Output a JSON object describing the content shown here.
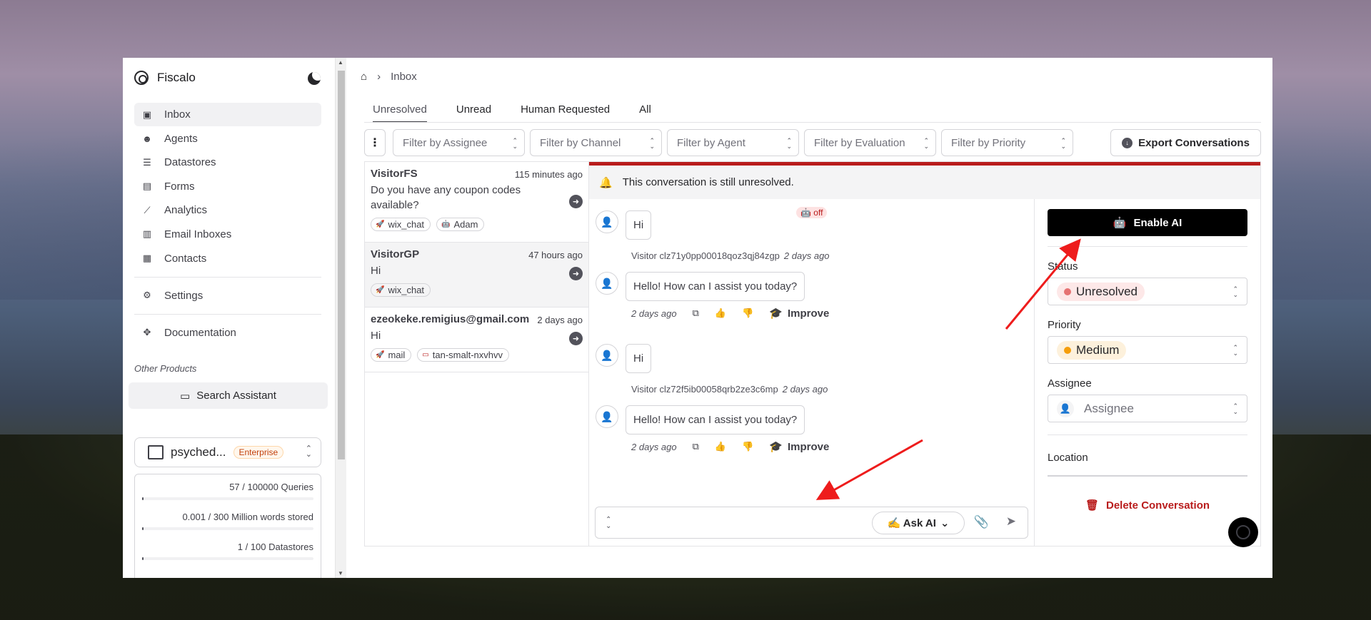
{
  "app": {
    "name": "Fiscalo"
  },
  "sidebar": {
    "items": [
      {
        "label": "Inbox",
        "icon": "inbox-icon",
        "glyph": "▣",
        "active": true
      },
      {
        "label": "Agents",
        "icon": "robot-icon",
        "glyph": "☻"
      },
      {
        "label": "Datastores",
        "icon": "database-icon",
        "glyph": "☰"
      },
      {
        "label": "Forms",
        "icon": "form-icon",
        "glyph": "▤"
      },
      {
        "label": "Analytics",
        "icon": "analytics-icon",
        "glyph": "⟋"
      },
      {
        "label": "Email Inboxes",
        "icon": "mail-inbox-icon",
        "glyph": "▥"
      },
      {
        "label": "Contacts",
        "icon": "contacts-icon",
        "glyph": "▦"
      }
    ],
    "settings": "Settings",
    "documentation": "Documentation",
    "other_products": "Other Products",
    "search_assistant": "Search Assistant",
    "org": {
      "name": "psyched...",
      "plan": "Enterprise"
    },
    "usage": [
      {
        "label": "57 / 100000 Queries",
        "fraction": 0.00057
      },
      {
        "label": "0.001 / 300 Million words stored",
        "fraction": 3.3e-06
      },
      {
        "label": "1 / 100 Datastores",
        "fraction": 0.01
      }
    ]
  },
  "breadcrumb": {
    "current": "Inbox"
  },
  "tabs": [
    "Unresolved",
    "Unread",
    "Human Requested",
    "All"
  ],
  "filters": {
    "assignee": "Filter by Assignee",
    "channel": "Filter by Channel",
    "agent": "Filter by Agent",
    "evaluation": "Filter by Evaluation",
    "priority": "Filter by Priority",
    "export": "Export Conversations"
  },
  "conversations": [
    {
      "name": "VisitorFS",
      "time": "115 minutes ago",
      "message": "Do you have any coupon codes available?",
      "tags": [
        "wix_chat",
        "Adam"
      ]
    },
    {
      "name": "VisitorGP",
      "time": "47 hours ago",
      "message": "Hi",
      "tags": [
        "wix_chat"
      ]
    },
    {
      "name": "ezeokeke.remigius@gmail.com",
      "time": "2 days ago",
      "message": "Hi",
      "tags": [
        "mail",
        "tan-smalt-nxvhvv"
      ]
    }
  ],
  "thread": {
    "banner": "This conversation is still unresolved.",
    "ai_badge": "off",
    "messages": [
      {
        "text": "Hi",
        "sender": "Visitor clz71y0pp00018qoz3qj84zgp",
        "time": "2 days ago"
      },
      {
        "text": "Hello! How can I assist you today?",
        "time": "2 days ago",
        "improve": "Improve"
      },
      {
        "text": "Hi",
        "sender": "Visitor clz72f5ib00058qrb2ze3c6mp",
        "time": "2 days ago"
      },
      {
        "text": "Hello! How can I assist you today?",
        "time": "2 days ago",
        "improve": "Improve"
      }
    ],
    "ask_ai": "✍️ Ask AI"
  },
  "details": {
    "enable_ai": "Enable AI",
    "status_label": "Status",
    "status_value": "Unresolved",
    "status_color": "#e57373",
    "status_bg": "#fde8e8",
    "priority_label": "Priority",
    "priority_value": "Medium",
    "priority_color": "#f59e0b",
    "priority_bg": "#fdf1dc",
    "assignee_label": "Assignee",
    "assignee_placeholder": "Assignee",
    "location_label": "Location",
    "delete": "Delete Conversation"
  }
}
